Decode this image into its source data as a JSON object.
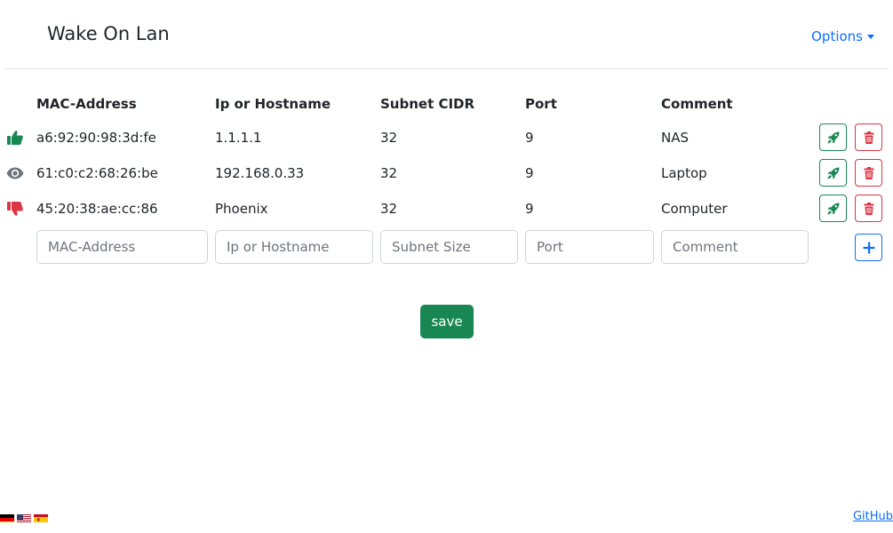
{
  "navbar": {
    "brand": "Wake On Lan",
    "options_label": "Options"
  },
  "table": {
    "headers": {
      "mac": "MAC-Address",
      "ip": "Ip or Hostname",
      "cidr": "Subnet CIDR",
      "port": "Port",
      "comment": "Comment"
    },
    "rows": [
      {
        "status": "thumbs-up-icon",
        "status_color": "#198754",
        "mac": "a6:92:90:98:3d:fe",
        "ip": "1.1.1.1",
        "cidr": "32",
        "port": "9",
        "comment": "NAS"
      },
      {
        "status": "eye-icon",
        "status_color": "#6c757d",
        "mac": "61:c0:c2:68:26:be",
        "ip": "192.168.0.33",
        "cidr": "32",
        "port": "9",
        "comment": "Laptop"
      },
      {
        "status": "thumbs-down-icon",
        "status_color": "#dc3545",
        "mac": "45:20:38:ae:cc:86",
        "ip": "Phoenix",
        "cidr": "32",
        "port": "9",
        "comment": "Computer"
      }
    ]
  },
  "new_row": {
    "mac_placeholder": "MAC-Address",
    "ip_placeholder": "Ip or Hostname",
    "cidr_placeholder": "Subnet Size",
    "port_placeholder": "Port",
    "comment_placeholder": "Comment"
  },
  "save_label": "save",
  "footer": {
    "languages": [
      "german-flag-icon",
      "us-flag-icon",
      "spanish-flag-icon"
    ],
    "github_label": "GitHub"
  },
  "colors": {
    "primary": "#0d6efd",
    "success": "#198754",
    "danger": "#dc3545",
    "muted": "#6c757d"
  }
}
